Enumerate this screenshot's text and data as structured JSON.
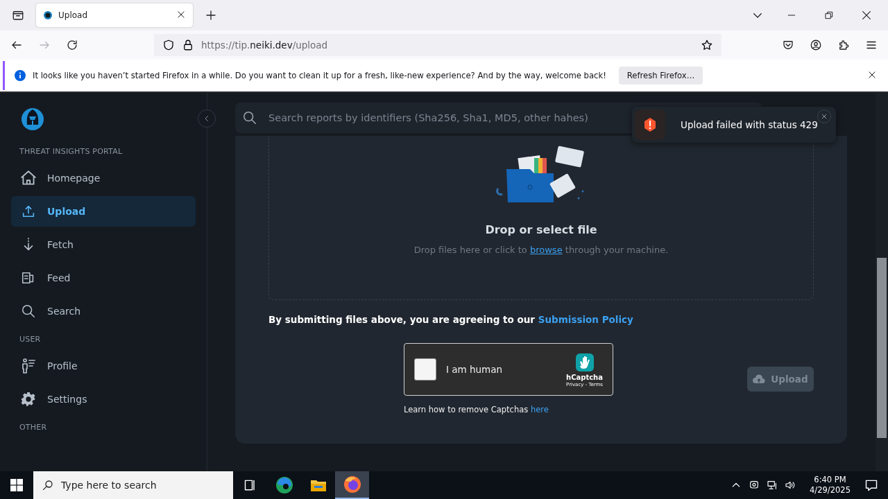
{
  "browser": {
    "tab": {
      "title": "Upload"
    },
    "url": {
      "scheme": "https://tip.",
      "domain": "neiki.dev",
      "path": "/upload"
    },
    "notification": {
      "message": "It looks like you haven’t started Firefox in a while. Do you want to clean it up for a fresh, like-new experience? And by the way, welcome back!",
      "button": "Refresh Firefox…"
    }
  },
  "sidebar": {
    "sections": [
      {
        "heading": "THREAT INSIGHTS PORTAL",
        "items": [
          {
            "label": "Homepage",
            "kind": "home",
            "selected": false
          },
          {
            "label": "Upload",
            "kind": "upload",
            "selected": true
          },
          {
            "label": "Fetch",
            "kind": "fetch",
            "selected": false
          },
          {
            "label": "Feed",
            "kind": "feed",
            "selected": false
          },
          {
            "label": "Search",
            "kind": "search",
            "selected": false
          }
        ]
      },
      {
        "heading": "USER",
        "items": [
          {
            "label": "Profile",
            "kind": "profile",
            "selected": false
          },
          {
            "label": "Settings",
            "kind": "settings",
            "selected": false
          }
        ]
      },
      {
        "heading": "OTHER"
      }
    ]
  },
  "search": {
    "placeholder": "Search reports by identifiers (Sha256, Sha1, MD5, other hahes)"
  },
  "dropzone": {
    "title": "Drop or select file",
    "hint_before": "Drop files here or click to",
    "link": "browse",
    "hint_after": "through your machine."
  },
  "agreement": {
    "text": "By submitting files above, you are agreeing to our",
    "link": "Submission Policy"
  },
  "captcha": {
    "label": "I am human",
    "checked": false,
    "brand": "hCaptcha",
    "links": "Privacy - Terms"
  },
  "captcha_help": {
    "text": "Learn how to remove Captchas",
    "link": "here"
  },
  "upload_button": {
    "label": "Upload",
    "disabled": true
  },
  "toast": {
    "message": "Upload failed with status 429"
  },
  "taskbar": {
    "search_placeholder": "Type here to search",
    "time": "6:40 PM",
    "date": "4/29/2025"
  }
}
